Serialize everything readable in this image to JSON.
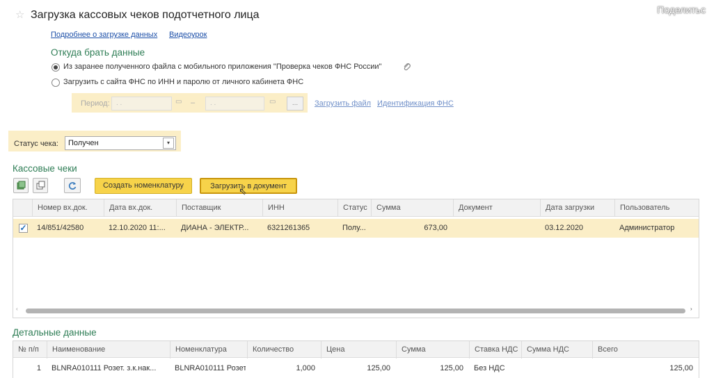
{
  "window": {
    "title": "Загрузка кассовых чеков подотчетного лица",
    "share_label": "Поделитьс"
  },
  "links": {
    "more_info": "Подробнее о загрузке данных",
    "video": "Видеоурок"
  },
  "source": {
    "heading": "Откуда брать данные",
    "options": [
      {
        "label": "Из заранее полученного файла с мобильного приложения \"Проверка чеков ФНС России\"",
        "selected": true
      },
      {
        "label": "Загрузить с сайта ФНС по ИНН и паролю от личного кабинета ФНС",
        "selected": false
      }
    ],
    "period_label": "Период:",
    "period_from": ". .",
    "period_to": ". .",
    "period_dash": "–",
    "period_more": "...",
    "load_file_link": "Загрузить файл",
    "fns_ident_link": "Идентификация ФНС"
  },
  "status_filter": {
    "label": "Статус чека:",
    "value": "Получен"
  },
  "receipts": {
    "heading": "Кассовые чеки",
    "create_nomenclature_btn": "Создать номенклатуру",
    "load_to_document_btn": "Загрузить в документ",
    "columns": [
      "Номер вх.док.",
      "Дата вх.док.",
      "Поставщик",
      "ИНН",
      "Статус",
      "Сумма",
      "Документ",
      "Дата загрузки",
      "Пользователь"
    ],
    "rows": [
      {
        "checked": true,
        "number": "14/851/42580",
        "date": "12.10.2020 11:...",
        "supplier": "ДИАНА - ЭЛЕКТР...",
        "inn": "6321261365",
        "status": "Полу...",
        "sum": "673,00",
        "document": "",
        "load_date": "03.12.2020",
        "user": "Администратор"
      }
    ]
  },
  "details": {
    "heading": "Детальные данные",
    "columns": [
      "№ п/п",
      "Наименование",
      "Номенклатура",
      "Количество",
      "Цена",
      "Сумма",
      "Ставка НДС",
      "Сумма НДС",
      "Всего"
    ],
    "rows": [
      {
        "n": "1",
        "name": "BLNRA010111 Розет. з.к.нак...",
        "nomenclature": "BLNRA010111 Розет. ...",
        "qty": "1,000",
        "price": "125,00",
        "sum": "125,00",
        "vat_rate": "Без НДС",
        "vat_sum": "",
        "total": "125,00"
      }
    ]
  },
  "icons": {
    "favorite": "star-icon",
    "clip": "paperclip-icon",
    "calendar": "calendar-icon",
    "refresh": "refresh-icon",
    "add_green": "add-row-icon",
    "copy": "copy-icon"
  }
}
